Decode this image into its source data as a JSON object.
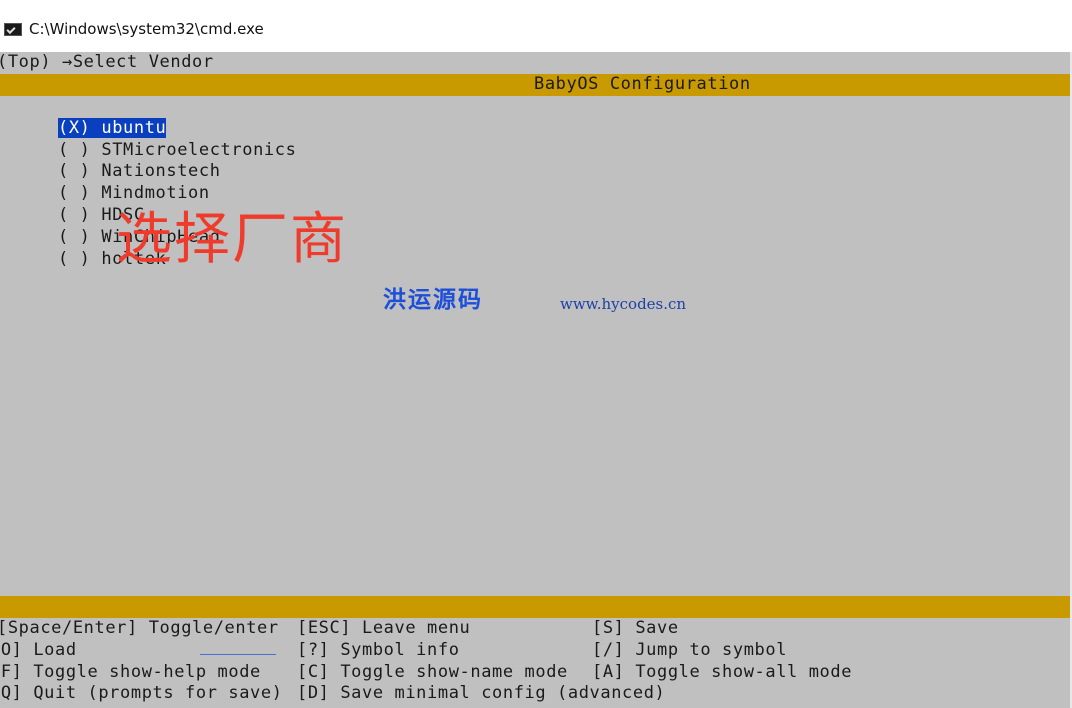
{
  "window": {
    "title": "C:\\Windows\\system32\\cmd.exe"
  },
  "console": {
    "breadcrumb": "(Top) →Select Vendor",
    "banner_title": "BabyOS Configuration",
    "options": [
      {
        "mark": "(X)",
        "label": "ubuntu",
        "selected": true
      },
      {
        "mark": "( )",
        "label": "STMicroelectronics",
        "selected": false
      },
      {
        "mark": "( )",
        "label": "Nationstech",
        "selected": false
      },
      {
        "mark": "( )",
        "label": "Mindmotion",
        "selected": false
      },
      {
        "mark": "( )",
        "label": "HDSC",
        "selected": false
      },
      {
        "mark": "( )",
        "label": "WinChipHead",
        "selected": false
      },
      {
        "mark": "( )",
        "label": "holtek",
        "selected": false
      }
    ],
    "help": [
      [
        "[Space/Enter] Toggle/enter",
        "[ESC] Leave menu",
        "[S] Save"
      ],
      [
        "[O] Load",
        "[?] Symbol info",
        "[/] Jump to symbol"
      ],
      [
        "[F] Toggle show-help mode",
        "[C] Toggle show-name mode",
        "[A] Toggle show-all mode"
      ],
      [
        "[Q] Quit (prompts for save)",
        "[D] Save minimal config (advanced)",
        ""
      ]
    ]
  },
  "overlays": {
    "caption": "选择厂商",
    "watermark_text": "洪运源码",
    "watermark_url": "www.hycodes.cn"
  },
  "colors": {
    "console_bg": "#c0c0c0",
    "banner": "#c99a00",
    "selection": "#0a3fbf",
    "caption_red": "#ef3b2c",
    "watermark_blue": "#1d4fd8"
  }
}
